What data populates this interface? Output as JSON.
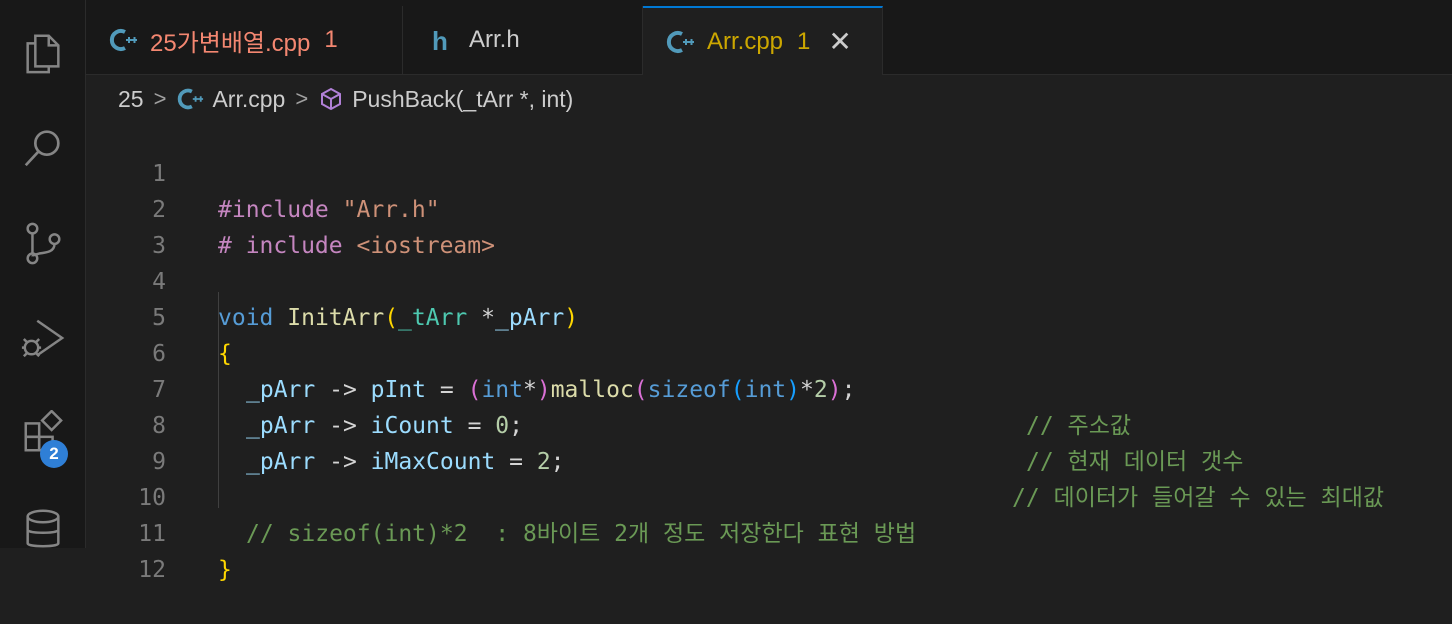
{
  "activity_bar": {
    "items": [
      "explorer-icon",
      "search-icon",
      "source-control-icon",
      "run-debug-icon",
      "extensions-icon",
      "database-icon"
    ],
    "extensions_badge": "2"
  },
  "tabs": [
    {
      "label": "25가변배열.cpp",
      "count": "1",
      "icon": "cpp-file-icon",
      "color": "#f48771"
    },
    {
      "label": "Arr.h",
      "count": "",
      "icon": "h-file-icon",
      "color": "#cccccc"
    },
    {
      "label": "Arr.cpp",
      "count": "1",
      "icon": "cpp-file-icon",
      "color": "#cca700",
      "active": true
    }
  ],
  "breadcrumb": {
    "folder": "25",
    "file": "Arr.cpp",
    "symbol": "PushBack(_tArr *, int)"
  },
  "code": {
    "line_numbers": [
      "1",
      "2",
      "3",
      "4",
      "5",
      "6",
      "7",
      "8",
      "9",
      "10",
      "11",
      "12"
    ],
    "l1": {
      "directive": "#include",
      "path": "\"Arr.h\""
    },
    "l2": {
      "directive": "# include",
      "path": "<iostream>"
    },
    "l4": {
      "kw": "void",
      "fn": "InitArr",
      "open": "(",
      "type": "_tArr",
      "star": " *",
      "param": "_pArr",
      "close": ")"
    },
    "l5": {
      "brace": "{"
    },
    "l6": {
      "var": "_pArr",
      "arrow": " -> ",
      "member": "pInt",
      "eq": " = ",
      "p1": "(",
      "kw_int": "int",
      "star": "*",
      "p1c": ")",
      "fn": "malloc",
      "p2": "(",
      "sizeof": "sizeof",
      "p3": "(",
      "kw_int2": "int",
      "p3c": ")",
      "mul": "*",
      "num": "2",
      "p2c": ")",
      "semi": ";",
      "comment": "// 주소값"
    },
    "l7": {
      "var": "_pArr",
      "arrow": " -> ",
      "member": "iCount",
      "eq": " = ",
      "num": "0",
      "semi": ";",
      "comment": "// 현재 데이터 갯수"
    },
    "l8": {
      "var": "_pArr",
      "arrow": " -> ",
      "member": "iMaxCount",
      "eq": " = ",
      "num": "2",
      "semi": ";",
      "comment": "// 데이터가 들어갈 수 있는 최대값"
    },
    "l10": {
      "comment": "// sizeof(int)*2  : 8바이트 2개 정도 저장한다 표현 방법"
    },
    "l11": {
      "brace": "}"
    }
  }
}
